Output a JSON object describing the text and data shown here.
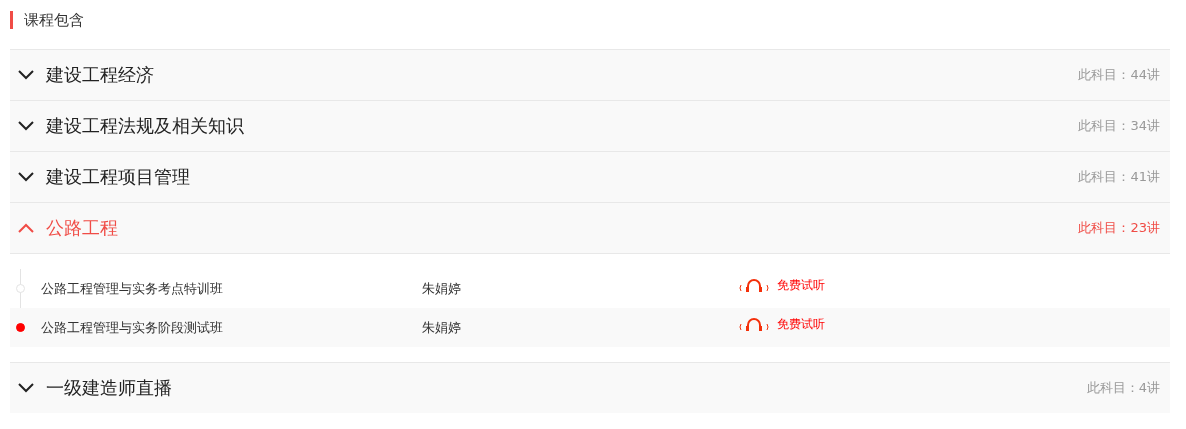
{
  "section_title": "课程包含",
  "subjects": [
    {
      "name": "建设工程经济",
      "count": "此科目：44讲",
      "expanded": false
    },
    {
      "name": "建设工程法规及相关知识",
      "count": "此科目：34讲",
      "expanded": false
    },
    {
      "name": "建设工程项目管理",
      "count": "此科目：41讲",
      "expanded": false
    },
    {
      "name": "公路工程",
      "count": "此科目：23讲",
      "expanded": true,
      "lessons": [
        {
          "title": "公路工程管理与实务考点特训班",
          "teacher": "朱娟婷",
          "action": "免费试听",
          "selected": false
        },
        {
          "title": "公路工程管理与实务阶段测试班",
          "teacher": "朱娟婷",
          "action": "免费试听",
          "selected": true
        }
      ]
    },
    {
      "name": "一级建造师直播",
      "count": "此科目：4讲",
      "expanded": false
    }
  ]
}
